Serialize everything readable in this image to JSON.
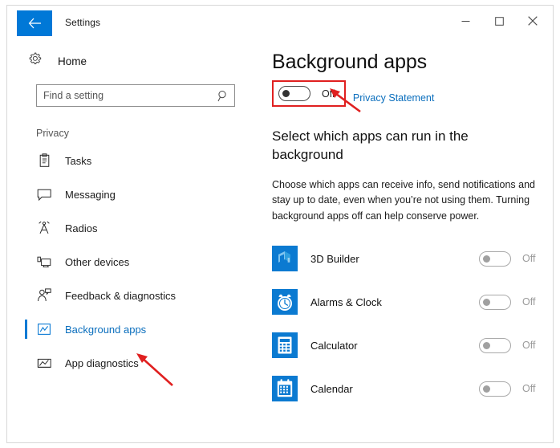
{
  "window": {
    "title": "Settings",
    "back_icon": "back-arrow-icon",
    "controls": {
      "minimize": "minimize-icon",
      "maximize": "maximize-icon",
      "close": "close-icon"
    }
  },
  "sidebar": {
    "home_label": "Home",
    "home_icon": "gear-icon",
    "search": {
      "placeholder": "Find a setting",
      "value": "",
      "icon": "search-icon"
    },
    "section_label": "Privacy",
    "items": [
      {
        "label": "Tasks",
        "icon": "clipboard-icon",
        "selected": false
      },
      {
        "label": "Messaging",
        "icon": "speech-bubble-icon",
        "selected": false
      },
      {
        "label": "Radios",
        "icon": "antenna-icon",
        "selected": false
      },
      {
        "label": "Other devices",
        "icon": "devices-icon",
        "selected": false
      },
      {
        "label": "Feedback & diagnostics",
        "icon": "feedback-person-icon",
        "selected": false
      },
      {
        "label": "Background apps",
        "icon": "background-apps-icon",
        "selected": true
      },
      {
        "label": "App diagnostics",
        "icon": "app-diagnostics-icon",
        "selected": false
      }
    ]
  },
  "main": {
    "page_title": "Background apps",
    "master_toggle": {
      "state": "Off",
      "on": false,
      "highlighted": true
    },
    "privacy_link": "Privacy Statement",
    "subheading": "Select which apps can run in the background",
    "description": "Choose which apps can receive info, send notifications and stay up to date, even when you’re not using them. Turning background apps off can help conserve power.",
    "apps": [
      {
        "name": "3D Builder",
        "state": "Off",
        "on": false,
        "icon": "3d-builder-icon",
        "disabled": true
      },
      {
        "name": "Alarms & Clock",
        "state": "Off",
        "on": false,
        "icon": "alarms-clock-icon",
        "disabled": true
      },
      {
        "name": "Calculator",
        "state": "Off",
        "on": false,
        "icon": "calculator-icon",
        "disabled": true
      },
      {
        "name": "Calendar",
        "state": "Off",
        "on": false,
        "icon": "calendar-icon",
        "disabled": true
      }
    ]
  },
  "annotations": {
    "accent_red": "#e02020",
    "accent_blue": "#0078d7",
    "arrow_to_master_toggle": "red-arrow-icon",
    "arrow_to_background_apps": "red-arrow-icon"
  }
}
